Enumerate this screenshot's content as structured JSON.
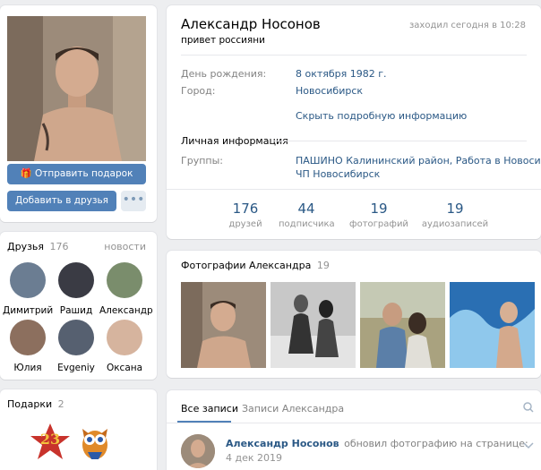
{
  "profile": {
    "name": "Александр Носонов",
    "status": "привет россияни",
    "last_seen": "заходил сегодня в 10:28",
    "info": [
      {
        "label": "День рождения:",
        "value": "8 октября 1982 г."
      },
      {
        "label": "Город:",
        "value": "Новосибирск"
      }
    ],
    "hide_info": "Скрыть подробную информацию",
    "personal_header": "Личная информация",
    "groups_label": "Группы:",
    "groups_line1": "ПАШИНО Калининский район, Работа в Новосибирске,",
    "groups_line2": "ЧП Новосибирск"
  },
  "buttons": {
    "gift": "Отправить подарок",
    "add_friend": "Добавить в друзья"
  },
  "counters": [
    {
      "num": "176",
      "label": "друзей"
    },
    {
      "num": "44",
      "label": "подписчика"
    },
    {
      "num": "19",
      "label": "фотографий"
    },
    {
      "num": "19",
      "label": "аудиозаписей"
    }
  ],
  "friends": {
    "title": "Друзья",
    "count": "176",
    "news": "новости",
    "items": [
      "Димитрий",
      "Рашид",
      "Александр",
      "Юлия",
      "Evgeniy",
      "Оксана"
    ]
  },
  "photos": {
    "title": "Фотографии Александра",
    "count": "19"
  },
  "gifts": {
    "title": "Подарки",
    "count": "2",
    "gift1_text": "23"
  },
  "wall": {
    "tabs": [
      "Все записи",
      "Записи Александра"
    ],
    "post_author": "Александр Носонов",
    "post_action": "обновил фотографию на странице:",
    "post_date": "4 дек 2019"
  }
}
